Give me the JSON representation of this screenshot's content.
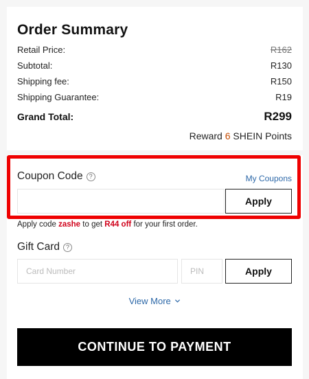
{
  "summary": {
    "title": "Order Summary",
    "rows": [
      {
        "label": "Retail Price:",
        "value": "R162",
        "strikethrough": true
      },
      {
        "label": "Subtotal:",
        "value": "R130"
      },
      {
        "label": "Shipping fee:",
        "value": "R150"
      },
      {
        "label": "Shipping Guarantee:",
        "value": "R19"
      }
    ],
    "grand_total_label": "Grand Total:",
    "grand_total_value": "R299",
    "reward_prefix": "Reward",
    "reward_points": "6",
    "reward_suffix": "SHEIN Points"
  },
  "coupon": {
    "label": "Coupon Code",
    "help_icon": "question-circle-icon",
    "my_coupons_link": "My Coupons",
    "input_value": "",
    "apply_label": "Apply",
    "hint_prefix": "Apply code",
    "hint_code": "zashe",
    "hint_middle": "to get",
    "hint_amount": "R44 off",
    "hint_suffix": "for your first order.",
    "highlight_color": "#ef0000"
  },
  "gift_card": {
    "label": "Gift Card",
    "help_icon": "question-circle-icon",
    "card_number_placeholder": "Card Number",
    "pin_placeholder": "PIN",
    "apply_label": "Apply"
  },
  "view_more": {
    "label": "View More",
    "icon": "chevron-down-icon"
  },
  "continue_button": "CONTINUE TO PAYMENT",
  "colors": {
    "link": "#2d68a8",
    "points": "#c44a01",
    "promo": "#d0021b",
    "primary_button": "#000000"
  }
}
